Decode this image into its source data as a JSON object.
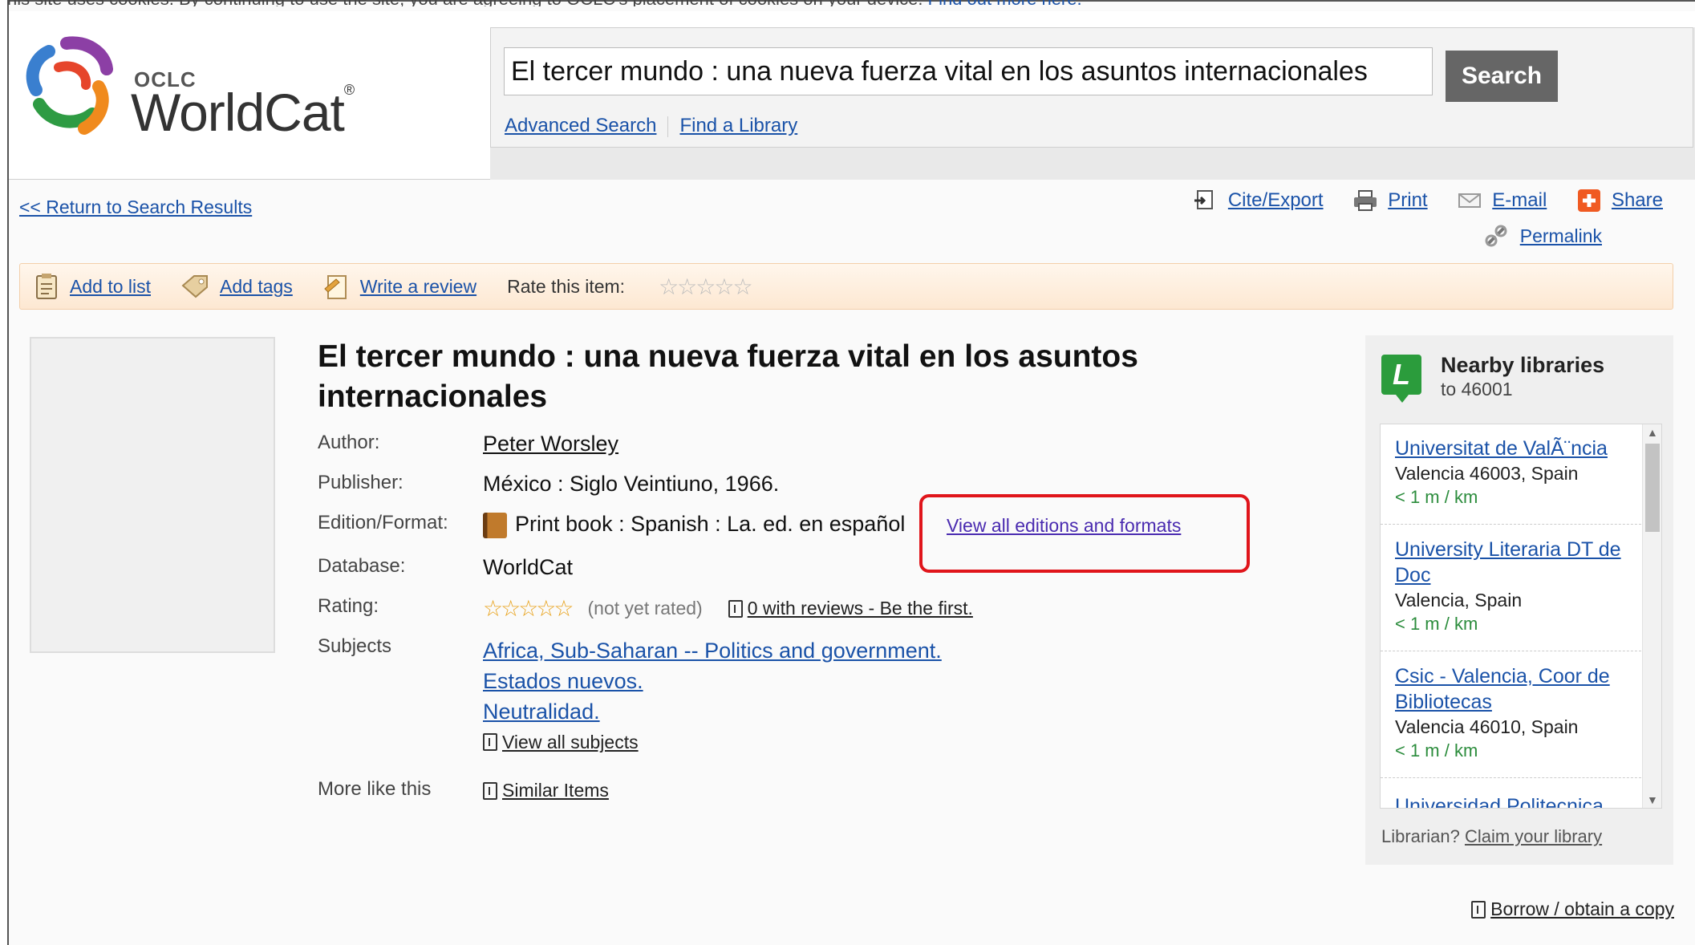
{
  "cookie_notice": {
    "text": "his site uses cookies. By continuing to use the site, you are agreeing to OCLC's placement of cookies on your device.",
    "link": "Find out more here."
  },
  "logo": {
    "oclc": "OCLC",
    "worldcat": "WorldCat"
  },
  "search": {
    "query": "El tercer mundo : una nueva fuerza vital en los asuntos internacionales",
    "button": "Search",
    "advanced": "Advanced Search",
    "find_library": "Find a Library"
  },
  "nav": {
    "return": "<< Return to Search Results",
    "cite": "Cite/Export",
    "print": "Print",
    "email": "E-mail",
    "share": "Share",
    "permalink": "Permalink"
  },
  "actions": {
    "add_list": "Add to list",
    "add_tags": "Add tags",
    "write_review": "Write a review",
    "rate_label": "Rate this item:",
    "rate_stars": "☆☆☆☆☆"
  },
  "record": {
    "title": "El tercer mundo : una nueva fuerza vital en los asuntos internacionales",
    "labels": {
      "author": "Author:",
      "publisher": "Publisher:",
      "edition": "Edition/Format:",
      "database": "Database:",
      "rating": "Rating:",
      "subjects": "Subjects",
      "more": "More like this"
    },
    "author": "Peter Worsley",
    "publisher": "México : Siglo Veintiuno, 1966.",
    "edition": "Print book : Spanish : La. ed. en español",
    "editions_link": "View all editions and formats",
    "database": "WorldCat",
    "rating_stars": "☆☆☆☆☆",
    "rating_note": "(not yet rated)",
    "reviews_link": "0 with reviews - Be the first.",
    "subjects": [
      "Africa, Sub-Saharan -- Politics and government.",
      "Estados nuevos.",
      "Neutralidad."
    ],
    "view_subjects": "View all subjects",
    "similar": "Similar Items"
  },
  "nearby": {
    "title": "Nearby libraries",
    "subtitle": "to 46001",
    "libraries": [
      {
        "name": "Universitat de ValÃ¨ncia",
        "addr": "Valencia 46003, Spain",
        "dist": "< 1 m / km"
      },
      {
        "name": "University Literaria DT de Doc",
        "addr": "Valencia, Spain",
        "dist": "< 1 m / km"
      },
      {
        "name": "Csic - Valencia, Coor de Bibliotecas",
        "addr": "Valencia 46010, Spain",
        "dist": "< 1 m / km"
      },
      {
        "name": "Universidad Politecnica",
        "addr": "",
        "dist": ""
      }
    ],
    "librarian": "Librarian?",
    "claim": "Claim your library"
  },
  "borrow": "Borrow / obtain a copy"
}
